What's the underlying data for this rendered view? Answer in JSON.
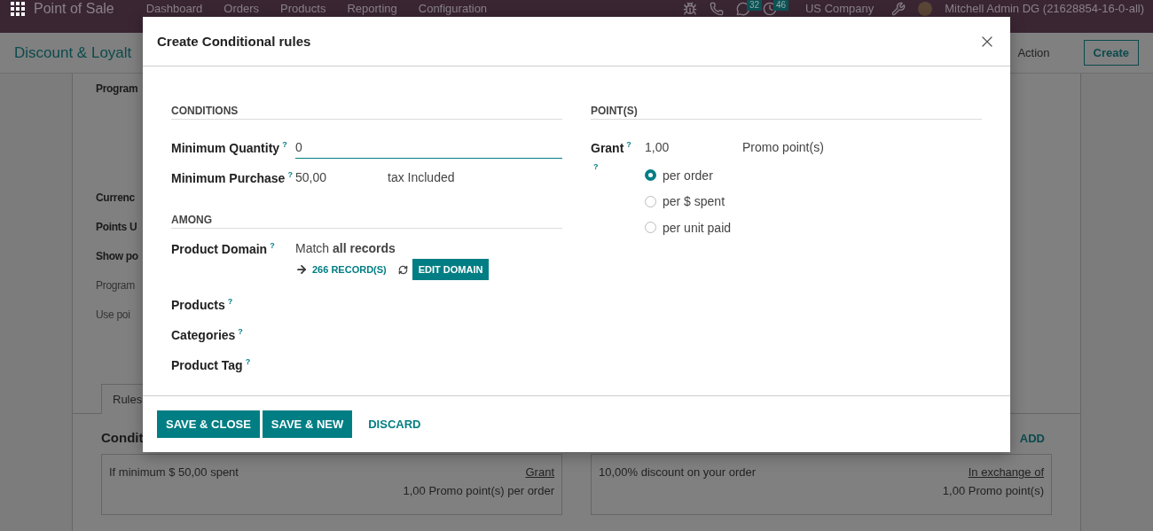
{
  "navbar": {
    "app_name": "Point of Sale",
    "menu": [
      "Dashboard",
      "Orders",
      "Products",
      "Reporting",
      "Configuration"
    ],
    "chat_count": "32",
    "activity_count": "46",
    "company": "US Company",
    "user": "Mitchell Admin DG (21628854-16-0-all)"
  },
  "control_panel": {
    "title": "Discount & Loyalt",
    "action": "Action",
    "create": "Create"
  },
  "form": {
    "labels": [
      {
        "text": "Program",
        "muted": false
      },
      {
        "text": "Currenc",
        "muted": false
      },
      {
        "text": "Points U",
        "muted": false
      },
      {
        "text": "Show po",
        "muted": false
      },
      {
        "text": "Program",
        "muted": true
      },
      {
        "text": "Use poi",
        "muted": true
      }
    ],
    "tab": "Rules",
    "section_title": "Condit",
    "add": "ADD",
    "cards": [
      {
        "text": "If minimum $ 50,00 spent",
        "heading": "Grant",
        "detail": "1,00 Promo point(s) per order"
      },
      {
        "text": "10,00% discount on your order",
        "heading": "In exchange of",
        "detail": "1,00 Promo point(s)"
      }
    ]
  },
  "dialog": {
    "title": "Create Conditional rules",
    "conditions": {
      "heading": "CONDITIONS",
      "fields": [
        {
          "label": "Minimum Quantity",
          "help": "?",
          "value": "0",
          "kind": "input"
        },
        {
          "label": "Minimum Purchase",
          "help": "?",
          "value": "50,00",
          "suffix": "tax Included",
          "kind": "amount"
        }
      ]
    },
    "among": {
      "heading": "AMONG",
      "domain": {
        "label": "Product Domain",
        "help": "?",
        "match": "Match **all records**",
        "records": "266 RECORD(S)",
        "edit": "EDIT DOMAIN"
      },
      "fields": [
        {
          "label": "Products",
          "help": "?"
        },
        {
          "label": "Categories",
          "help": "?"
        },
        {
          "label": "Product Tag",
          "help": "?"
        }
      ]
    },
    "points": {
      "heading": "POINT(S)",
      "grant": {
        "label": "Grant",
        "help": "?",
        "value": "1,00",
        "unit": "Promo point(s)"
      },
      "mode_help": "?",
      "options": [
        {
          "label": "per order",
          "selected": true
        },
        {
          "label": "per $ spent",
          "selected": false
        },
        {
          "label": "per unit paid",
          "selected": false
        }
      ]
    },
    "buttons": [
      {
        "label": "SAVE & CLOSE",
        "kind": "primary"
      },
      {
        "label": "SAVE & NEW",
        "kind": "primary"
      },
      {
        "label": "DISCARD",
        "kind": "link"
      }
    ]
  }
}
